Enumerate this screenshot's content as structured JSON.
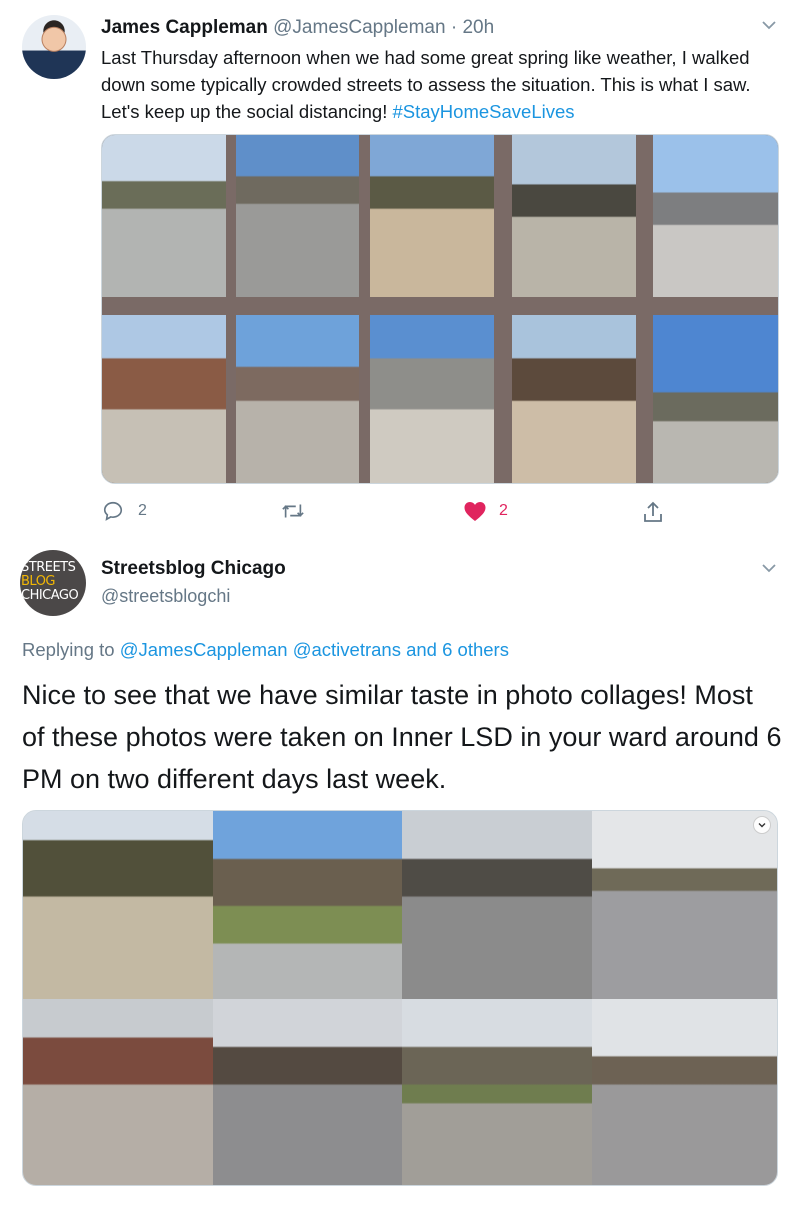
{
  "tweet1": {
    "author_name": "James Cappleman",
    "handle": "@JamesCappleman",
    "separator": "·",
    "time": "20h",
    "text": "Last Thursday afternoon when we had some great spring like weather, I walked down some typically crowded streets to assess the situation. This is what I saw. Let's keep up the social distancing! ",
    "hashtag": "#StayHomeSaveLives",
    "actions": {
      "reply_icon": "reply-bubble-icon",
      "reply_count": "2",
      "retweet_icon": "retweet-icon",
      "like_icon": "heart-filled-icon",
      "like_count": "2",
      "share_icon": "share-icon"
    }
  },
  "tweet2": {
    "author_name": "Streetsblog Chicago",
    "handle": "@streetsblogchi",
    "avatar_lines": [
      "STREETS",
      "BLOG",
      "CHICAGO"
    ],
    "replying_prefix": "Replying to ",
    "replying_users": "@JamesCappleman @activetrans",
    "replying_others": " and 6 others",
    "text": "Nice to see that we have similar taste in photo collages! Most of these photos were taken on Inner LSD in your ward around 6 PM on two different days last week."
  },
  "colors": {
    "link": "#1b95e0",
    "muted": "#657786",
    "like": "#e0245e",
    "collage_frame": "#7a6a66"
  }
}
